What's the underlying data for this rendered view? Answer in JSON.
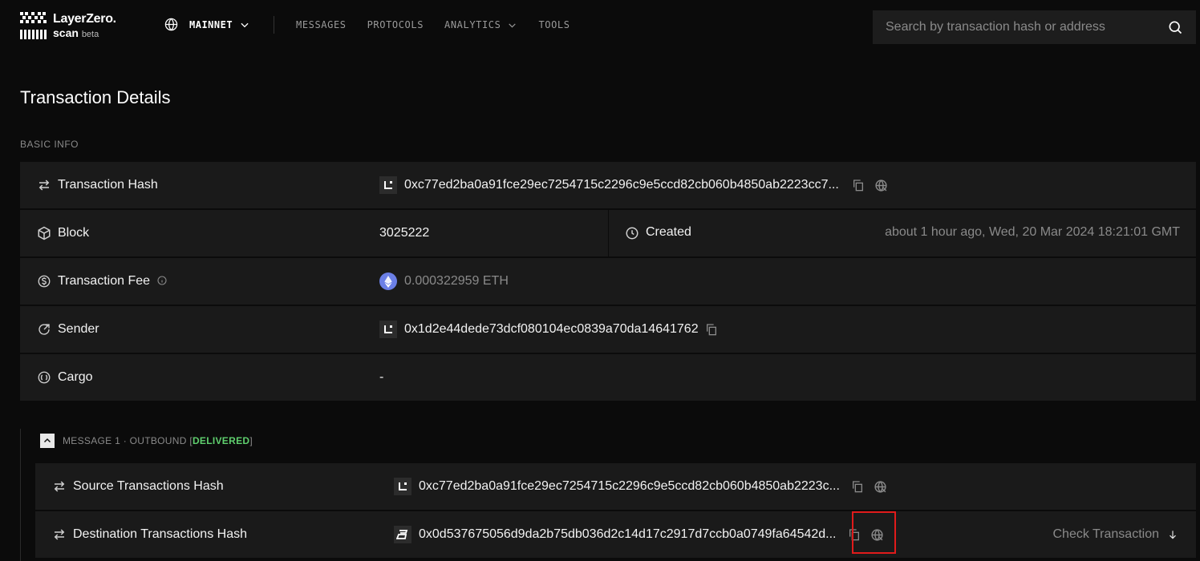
{
  "header": {
    "logo_line1": "LayerZero.",
    "logo_line2": "scan",
    "logo_beta": "beta",
    "network_label": "MAINNET",
    "nav": [
      "MESSAGES",
      "PROTOCOLS",
      "ANALYTICS",
      "TOOLS"
    ],
    "search_placeholder": "Search by transaction hash or address"
  },
  "page_title": "Transaction Details",
  "basic_info": {
    "section_label": "BASIC INFO",
    "transaction_hash": {
      "label": "Transaction Hash",
      "value": "0xc77ed2ba0a91fce29ec7254715c2296c9e5ccd82cb060b4850ab2223cc7..."
    },
    "block": {
      "label": "Block",
      "value": "3025222"
    },
    "created": {
      "label": "Created",
      "value": "about 1 hour ago, Wed, 20 Mar 2024 18:21:01 GMT"
    },
    "transaction_fee": {
      "label": "Transaction Fee",
      "value": "0.000322959 ETH"
    },
    "sender": {
      "label": "Sender",
      "value": "0x1d2e44dede73dcf080104ec0839a70da14641762"
    },
    "cargo": {
      "label": "Cargo",
      "value": "-"
    }
  },
  "message": {
    "prefix": "MESSAGE 1 · OUTBOUND [ ",
    "status": "DELIVERED",
    "suffix": " ]",
    "source_hash": {
      "label": "Source Transactions Hash",
      "value": "0xc77ed2ba0a91fce29ec7254715c2296c9e5ccd82cb060b4850ab2223c..."
    },
    "destination_hash": {
      "label": "Destination Transactions Hash",
      "value": "0x0d537675056d9da2b75db036d2c14d17c2917d7ccb0a0749fa64542d...",
      "action": "Check Transaction"
    }
  },
  "colors": {
    "accent_delivered": "#5fcf6e",
    "highlight": "#e01b1b",
    "eth": "#6b7fe6"
  }
}
